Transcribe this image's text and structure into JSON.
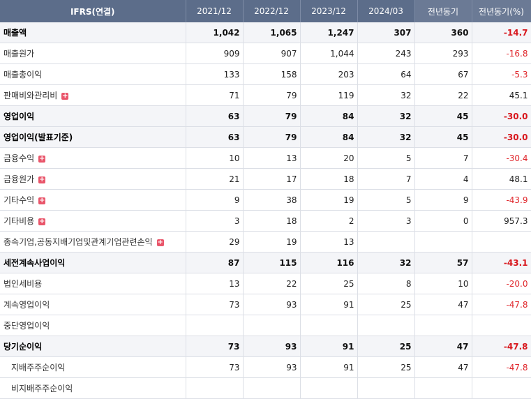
{
  "header": [
    "IFRS(연결)",
    "2021/12",
    "2022/12",
    "2023/12",
    "2024/03",
    "전년동기",
    "전년동기(%)"
  ],
  "rows": [
    {
      "label": "매출액",
      "bold": true,
      "expand": false,
      "sub": false,
      "v": [
        "1,042",
        "1,065",
        "1,247",
        "307",
        "360",
        "-14.7"
      ],
      "neg": true
    },
    {
      "label": "매출원가",
      "bold": false,
      "expand": false,
      "sub": false,
      "v": [
        "909",
        "907",
        "1,044",
        "243",
        "293",
        "-16.8"
      ],
      "neg": true
    },
    {
      "label": "매출총이익",
      "bold": false,
      "expand": false,
      "sub": false,
      "v": [
        "133",
        "158",
        "203",
        "64",
        "67",
        "-5.3"
      ],
      "neg": true
    },
    {
      "label": "판매비와관리비",
      "bold": false,
      "expand": true,
      "sub": false,
      "v": [
        "71",
        "79",
        "119",
        "32",
        "22",
        "45.1"
      ],
      "neg": false
    },
    {
      "label": "영업이익",
      "bold": true,
      "expand": false,
      "sub": false,
      "v": [
        "63",
        "79",
        "84",
        "32",
        "45",
        "-30.0"
      ],
      "neg": true
    },
    {
      "label": "영업이익(발표기준)",
      "bold": true,
      "expand": false,
      "sub": false,
      "v": [
        "63",
        "79",
        "84",
        "32",
        "45",
        "-30.0"
      ],
      "neg": true
    },
    {
      "label": "금융수익",
      "bold": false,
      "expand": true,
      "sub": false,
      "v": [
        "10",
        "13",
        "20",
        "5",
        "7",
        "-30.4"
      ],
      "neg": true
    },
    {
      "label": "금융원가",
      "bold": false,
      "expand": true,
      "sub": false,
      "v": [
        "21",
        "17",
        "18",
        "7",
        "4",
        "48.1"
      ],
      "neg": false
    },
    {
      "label": "기타수익",
      "bold": false,
      "expand": true,
      "sub": false,
      "v": [
        "9",
        "38",
        "19",
        "5",
        "9",
        "-43.9"
      ],
      "neg": true
    },
    {
      "label": "기타비용",
      "bold": false,
      "expand": true,
      "sub": false,
      "v": [
        "3",
        "18",
        "2",
        "3",
        "0",
        "957.3"
      ],
      "neg": false
    },
    {
      "label": "종속기업,공동지배기업및관계기업관련손익",
      "bold": false,
      "expand": true,
      "sub": false,
      "v": [
        "29",
        "19",
        "13",
        "",
        "",
        ""
      ],
      "neg": false
    },
    {
      "label": "세전계속사업이익",
      "bold": true,
      "expand": false,
      "sub": false,
      "v": [
        "87",
        "115",
        "116",
        "32",
        "57",
        "-43.1"
      ],
      "neg": true
    },
    {
      "label": "법인세비용",
      "bold": false,
      "expand": false,
      "sub": false,
      "v": [
        "13",
        "22",
        "25",
        "8",
        "10",
        "-20.0"
      ],
      "neg": true
    },
    {
      "label": "계속영업이익",
      "bold": false,
      "expand": false,
      "sub": false,
      "v": [
        "73",
        "93",
        "91",
        "25",
        "47",
        "-47.8"
      ],
      "neg": true
    },
    {
      "label": "중단영업이익",
      "bold": false,
      "expand": false,
      "sub": false,
      "v": [
        "",
        "",
        "",
        "",
        "",
        ""
      ],
      "neg": false
    },
    {
      "label": "당기순이익",
      "bold": true,
      "expand": false,
      "sub": false,
      "v": [
        "73",
        "93",
        "91",
        "25",
        "47",
        "-47.8"
      ],
      "neg": true
    },
    {
      "label": "지배주주순이익",
      "bold": false,
      "expand": false,
      "sub": true,
      "v": [
        "73",
        "93",
        "91",
        "25",
        "47",
        "-47.8"
      ],
      "neg": true
    },
    {
      "label": "비지배주주순이익",
      "bold": false,
      "expand": false,
      "sub": true,
      "v": [
        "",
        "",
        "",
        "",
        "",
        ""
      ],
      "neg": false
    }
  ]
}
